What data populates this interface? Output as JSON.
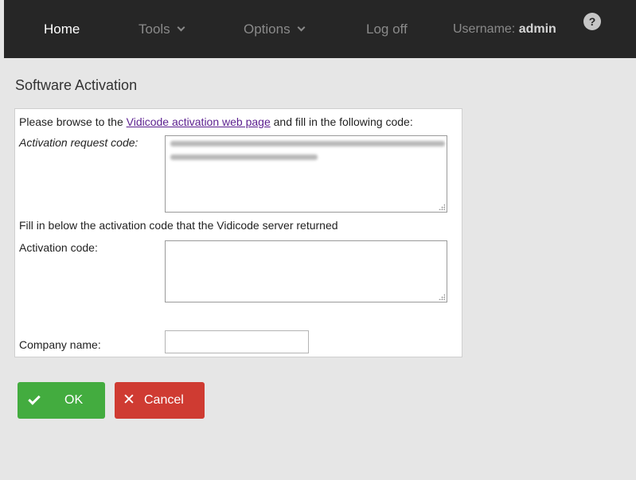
{
  "nav": {
    "home": "Home",
    "tools": "Tools",
    "options": "Options",
    "logoff": "Log off",
    "username_label": "Username:",
    "username_value": "admin",
    "help_glyph": "?"
  },
  "page": {
    "title": "Software Activation"
  },
  "form": {
    "intro_before": "Please browse to the ",
    "intro_link": "Vidicode activation web page",
    "intro_after": " and fill in the following code:",
    "request_code_label": "Activation request code:",
    "request_code_value": "",
    "fill_in_text": "Fill in below the activation code that the Vidicode server returned",
    "activation_code_label": "Activation code:",
    "activation_code_value": "",
    "company_name_label": "Company name:",
    "company_name_value": ""
  },
  "buttons": {
    "ok": "OK",
    "cancel": "Cancel"
  },
  "colors": {
    "navbar": "#262626",
    "ok": "#43ac3f",
    "cancel": "#cf3b32",
    "link": "#5b1f8f"
  },
  "icons": {
    "help": "question-circle-icon",
    "chevron": "chevron-down-icon",
    "ok": "check-icon",
    "cancel": "x-icon"
  }
}
